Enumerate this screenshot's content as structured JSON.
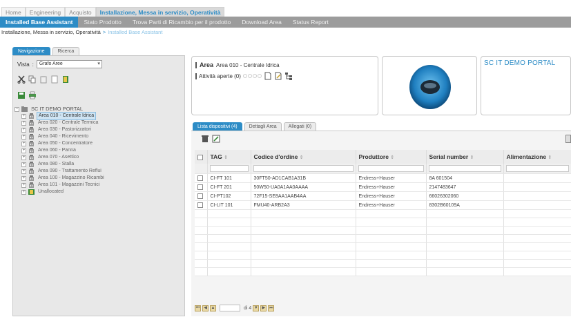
{
  "top_tabs": [
    {
      "label": "Home",
      "active": false
    },
    {
      "label": "Engineering",
      "active": false
    },
    {
      "label": "Acquisto",
      "active": false
    },
    {
      "label": "Installazione, Messa in servizio, Operatività",
      "active": true
    }
  ],
  "sub_tabs": [
    {
      "label": "Installed Base Assistant",
      "active": true
    },
    {
      "label": "Stato Prodotto",
      "active": false
    },
    {
      "label": "Trova Parti di Ricambio per il prodotto",
      "active": false
    },
    {
      "label": "Download Area",
      "active": false
    },
    {
      "label": "Status Report",
      "active": false
    }
  ],
  "breadcrumb": {
    "parent": "Installazione, Messa in servizio, Operatività",
    "separator": ">",
    "current": "Installed Base Assistant"
  },
  "left_tabs": [
    {
      "label": "Navigazione",
      "active": true
    },
    {
      "label": "Ricerca",
      "active": false
    }
  ],
  "vista": {
    "label": "Vista",
    "value": "Grafo Aree"
  },
  "tree": {
    "root": "SC IT DEMO PORTAL",
    "items": [
      {
        "label": "Area 010 - Centrale Idrica",
        "selected": true
      },
      {
        "label": "Area 020 - Centrale Termica",
        "selected": false
      },
      {
        "label": "Area 030 - Pastorizzatori",
        "selected": false
      },
      {
        "label": "Area 040 - Ricevimento",
        "selected": false
      },
      {
        "label": "Area 050 - Concentratore",
        "selected": false
      },
      {
        "label": "Area 060 - Panna",
        "selected": false
      },
      {
        "label": "Area 070 - Asettico",
        "selected": false
      },
      {
        "label": "Area 080 - Stalla",
        "selected": false
      },
      {
        "label": "Area 090 - Trattamento Reflui",
        "selected": false
      },
      {
        "label": "Area 100 - Magazzino Ricambi",
        "selected": false
      },
      {
        "label": "Area 101 - Magazzini Tecnici",
        "selected": false
      },
      {
        "label": "Unallocated",
        "selected": false
      }
    ]
  },
  "area_box": {
    "area_label": "Area",
    "area_value": "Area 010 - Centrale Idrica",
    "activity_label": "Attività aperte (0)"
  },
  "portal_title": "SC IT DEMO PORTAL",
  "right_tabs": [
    {
      "label": "Lista dispositivi (4)",
      "active": true
    },
    {
      "label": "Dettagli Area",
      "active": false
    },
    {
      "label": "Allegati (0)",
      "active": false
    }
  ],
  "table": {
    "columns": [
      "TAG",
      "Codice d'ordine",
      "Produttore",
      "Serial number",
      "Alimentazione"
    ],
    "sort_glyph": "⇕",
    "rows": [
      {
        "tag": "CI-FT 101",
        "order_code": "30FT50-AD1CAB1A31B",
        "maker": "Endress+Hauser",
        "serial": "8A 601504",
        "power": ""
      },
      {
        "tag": "CI-FT 201",
        "order_code": "50W50-UA0A1AA0AAAA",
        "maker": "Endress+Hauser",
        "serial": "2147483647",
        "power": ""
      },
      {
        "tag": "CI-PT102",
        "order_code": "72F15-SE8AA1AAB4AA",
        "maker": "Endress+Hauser",
        "serial": "66026302060",
        "power": ""
      },
      {
        "tag": "CI-LIT 101",
        "order_code": "FMU40-ARB2A3",
        "maker": "Endress+Hauser",
        "serial": "8302B60109A",
        "power": ""
      }
    ],
    "empty_rows": 8
  },
  "pager": {
    "of_label": "di 4"
  },
  "colors": {
    "accent": "#2d8cc6",
    "subnav": "#9c9c9c",
    "panel": "#e8e8e8"
  }
}
